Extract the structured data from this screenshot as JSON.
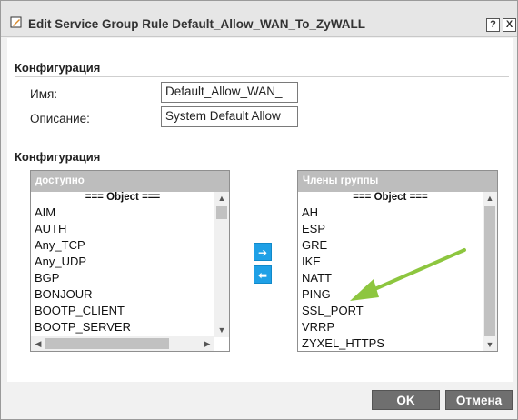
{
  "dialog": {
    "title": "Edit Service Group Rule Default_Allow_WAN_To_ZyWALL",
    "help_label": "?",
    "close_label": "X"
  },
  "section1": {
    "title": "Конфигурация",
    "name_label": "Имя:",
    "name_value": "Default_Allow_WAN_",
    "desc_label": "Описание:",
    "desc_value": "System Default Allow"
  },
  "section2": {
    "title": "Конфигурация"
  },
  "available": {
    "header": "доступно",
    "group_label": "=== Object ===",
    "items": [
      "AIM",
      "AUTH",
      "Any_TCP",
      "Any_UDP",
      "BGP",
      "BONJOUR",
      "BOOTP_CLIENT",
      "BOOTP_SERVER"
    ]
  },
  "members": {
    "header": "Члены группы",
    "group_label": "=== Object ===",
    "items": [
      "AH",
      "ESP",
      "GRE",
      "IKE",
      "NATT",
      "PING",
      "SSL_PORT",
      "VRRP",
      "ZYXEL_HTTPS"
    ]
  },
  "controls": {
    "add_icon": "arrow-right-icon",
    "remove_icon": "arrow-left-icon",
    "add_label": "➔",
    "remove_label": "⬅",
    "highlight_color": "#8dc63f"
  },
  "footer": {
    "ok_label": "OK",
    "cancel_label": "Отмена"
  }
}
